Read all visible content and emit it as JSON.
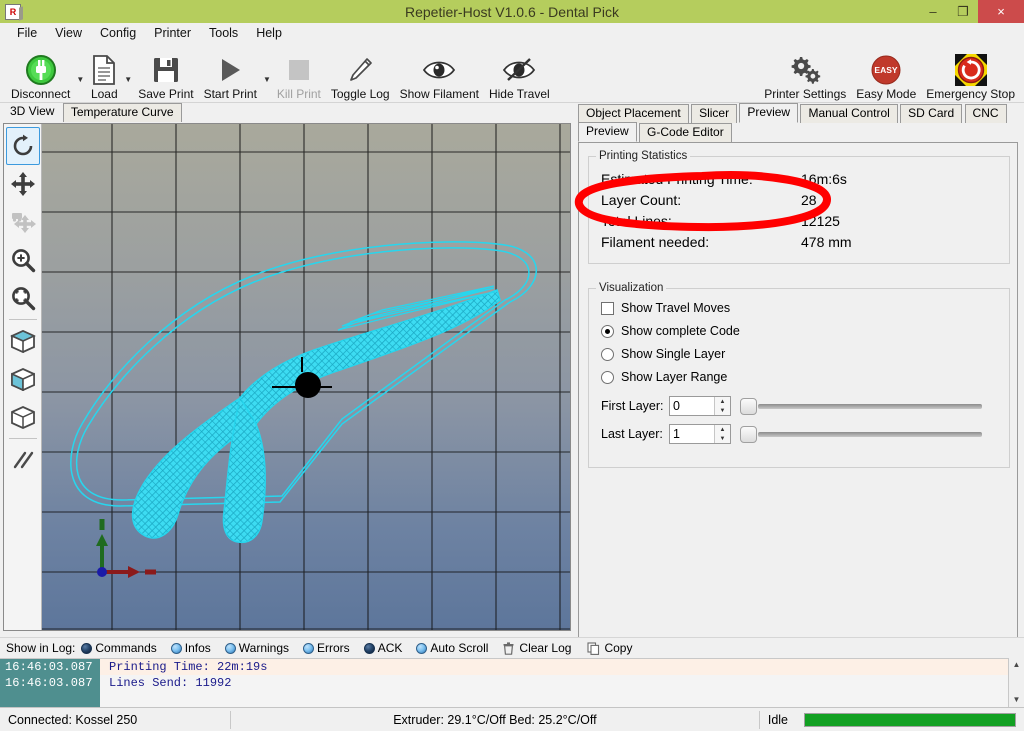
{
  "window": {
    "title": "Repetier-Host V1.0.6 - Dental Pick",
    "app_icon": "R",
    "minimize": "–",
    "maximize": "❐",
    "close": "×",
    "titlebar_color": "#b5cd5d",
    "close_color": "#cc4b4b"
  },
  "menu": [
    {
      "label": "File"
    },
    {
      "label": "View"
    },
    {
      "label": "Config"
    },
    {
      "label": "Printer"
    },
    {
      "label": "Tools"
    },
    {
      "label": "Help"
    }
  ],
  "toolbar_left": [
    {
      "label": "Disconnect",
      "icon": "power-plug-icon",
      "dropdown": true,
      "disabled": false
    },
    {
      "label": "Load",
      "icon": "document-icon",
      "dropdown": true,
      "disabled": false
    },
    {
      "label": "Save Print",
      "icon": "floppy-disk-icon",
      "dropdown": false,
      "disabled": false
    },
    {
      "label": "Start Print",
      "icon": "play-triangle-icon",
      "dropdown": true,
      "disabled": false
    },
    {
      "label": "Kill Print",
      "icon": "stop-square-icon",
      "dropdown": false,
      "disabled": true
    },
    {
      "label": "Toggle Log",
      "icon": "pencil-icon",
      "dropdown": false,
      "disabled": false
    },
    {
      "label": "Show Filament",
      "icon": "eye-icon",
      "dropdown": false,
      "disabled": false
    },
    {
      "label": "Hide Travel",
      "icon": "eye-slash-icon",
      "dropdown": false,
      "disabled": false
    }
  ],
  "toolbar_right": [
    {
      "label": "Printer Settings",
      "icon": "gears-icon"
    },
    {
      "label": "Easy Mode",
      "icon": "easy-badge-icon",
      "badge_text": "EASY"
    },
    {
      "label": "Emergency Stop",
      "icon": "emergency-stop-icon"
    }
  ],
  "left_tabs": [
    {
      "label": "3D View",
      "active": true
    },
    {
      "label": "Temperature Curve",
      "active": false
    }
  ],
  "view_tools": [
    {
      "name": "rotate-view-tool",
      "selected": true
    },
    {
      "name": "move-view-tool",
      "selected": false
    },
    {
      "name": "move-object-tool",
      "selected": false,
      "disabled": true
    },
    {
      "name": "zoom-tool",
      "selected": false
    },
    {
      "name": "zoom-fit-tool",
      "selected": false
    },
    {
      "name": "view-mode-flat-tool",
      "selected": false
    },
    {
      "name": "view-mode-solid-tool",
      "selected": false
    },
    {
      "name": "view-mode-wireframe-tool",
      "selected": false
    },
    {
      "name": "parallel-lines-tool",
      "selected": false
    }
  ],
  "viewport": {
    "bg_top_color": "#a9a99c",
    "bg_bottom_color": "#5d769b",
    "grid_color": "#101010",
    "model_color": "#27d6ee",
    "axis_x_color": "#8b1a1a",
    "axis_z_color": "#1f6b1f",
    "origin_color": "#1a1aa8",
    "marker_color": "#000000"
  },
  "right_tabs": [
    {
      "label": "Object Placement",
      "active": false
    },
    {
      "label": "Slicer",
      "active": false
    },
    {
      "label": "Preview",
      "active": true
    },
    {
      "label": "Manual Control",
      "active": false
    },
    {
      "label": "SD Card",
      "active": false
    },
    {
      "label": "CNC",
      "active": false
    }
  ],
  "right_subtabs": [
    {
      "label": "Preview",
      "active": true
    },
    {
      "label": "G-Code Editor",
      "active": false
    }
  ],
  "printing_statistics": {
    "group_title": "Printing Statistics",
    "rows": [
      {
        "label": "Estimated Printing Time:",
        "value": "16m:6s"
      },
      {
        "label": "Layer Count:",
        "value": "28"
      },
      {
        "label": "Total Lines:",
        "value": "12125"
      },
      {
        "label": "Filament needed:",
        "value": "478 mm"
      }
    ]
  },
  "visualization": {
    "group_title": "Visualization",
    "checkbox": {
      "label": "Show Travel Moves",
      "checked": false
    },
    "radios": [
      {
        "label": "Show complete Code",
        "selected": true
      },
      {
        "label": "Show Single Layer",
        "selected": false
      },
      {
        "label": "Show Layer Range",
        "selected": false
      }
    ],
    "first_layer": {
      "label": "First Layer:",
      "value": "0"
    },
    "last_layer": {
      "label": "Last Layer:",
      "value": "1"
    }
  },
  "annotation": {
    "shape": "red-ellipse-highlight",
    "color": "#ff0000",
    "targets": "Layer Count: 28"
  },
  "log_toolbar": {
    "label": "Show in Log:",
    "filters": [
      {
        "label": "Commands",
        "on": true
      },
      {
        "label": "Infos",
        "on": false
      },
      {
        "label": "Warnings",
        "on": false
      },
      {
        "label": "Errors",
        "on": false
      },
      {
        "label": "ACK",
        "on": true
      },
      {
        "label": "Auto Scroll",
        "on": false
      }
    ],
    "actions": [
      {
        "label": "Clear Log",
        "icon": "trash-icon"
      },
      {
        "label": "Copy",
        "icon": "copy-icon"
      }
    ]
  },
  "log_lines": [
    {
      "time": "16:46:03.087",
      "message": "Printing Time: 22m:19s"
    },
    {
      "time": "16:46:03.087",
      "message": "Lines Send: 11992"
    }
  ],
  "statusbar": {
    "connection": "Connected: Kossel 250",
    "temperatures": "Extruder: 29.1°C/Off Bed: 25.2°C/Off",
    "state": "Idle",
    "progress_percent": 100,
    "progress_color": "#12a022"
  }
}
